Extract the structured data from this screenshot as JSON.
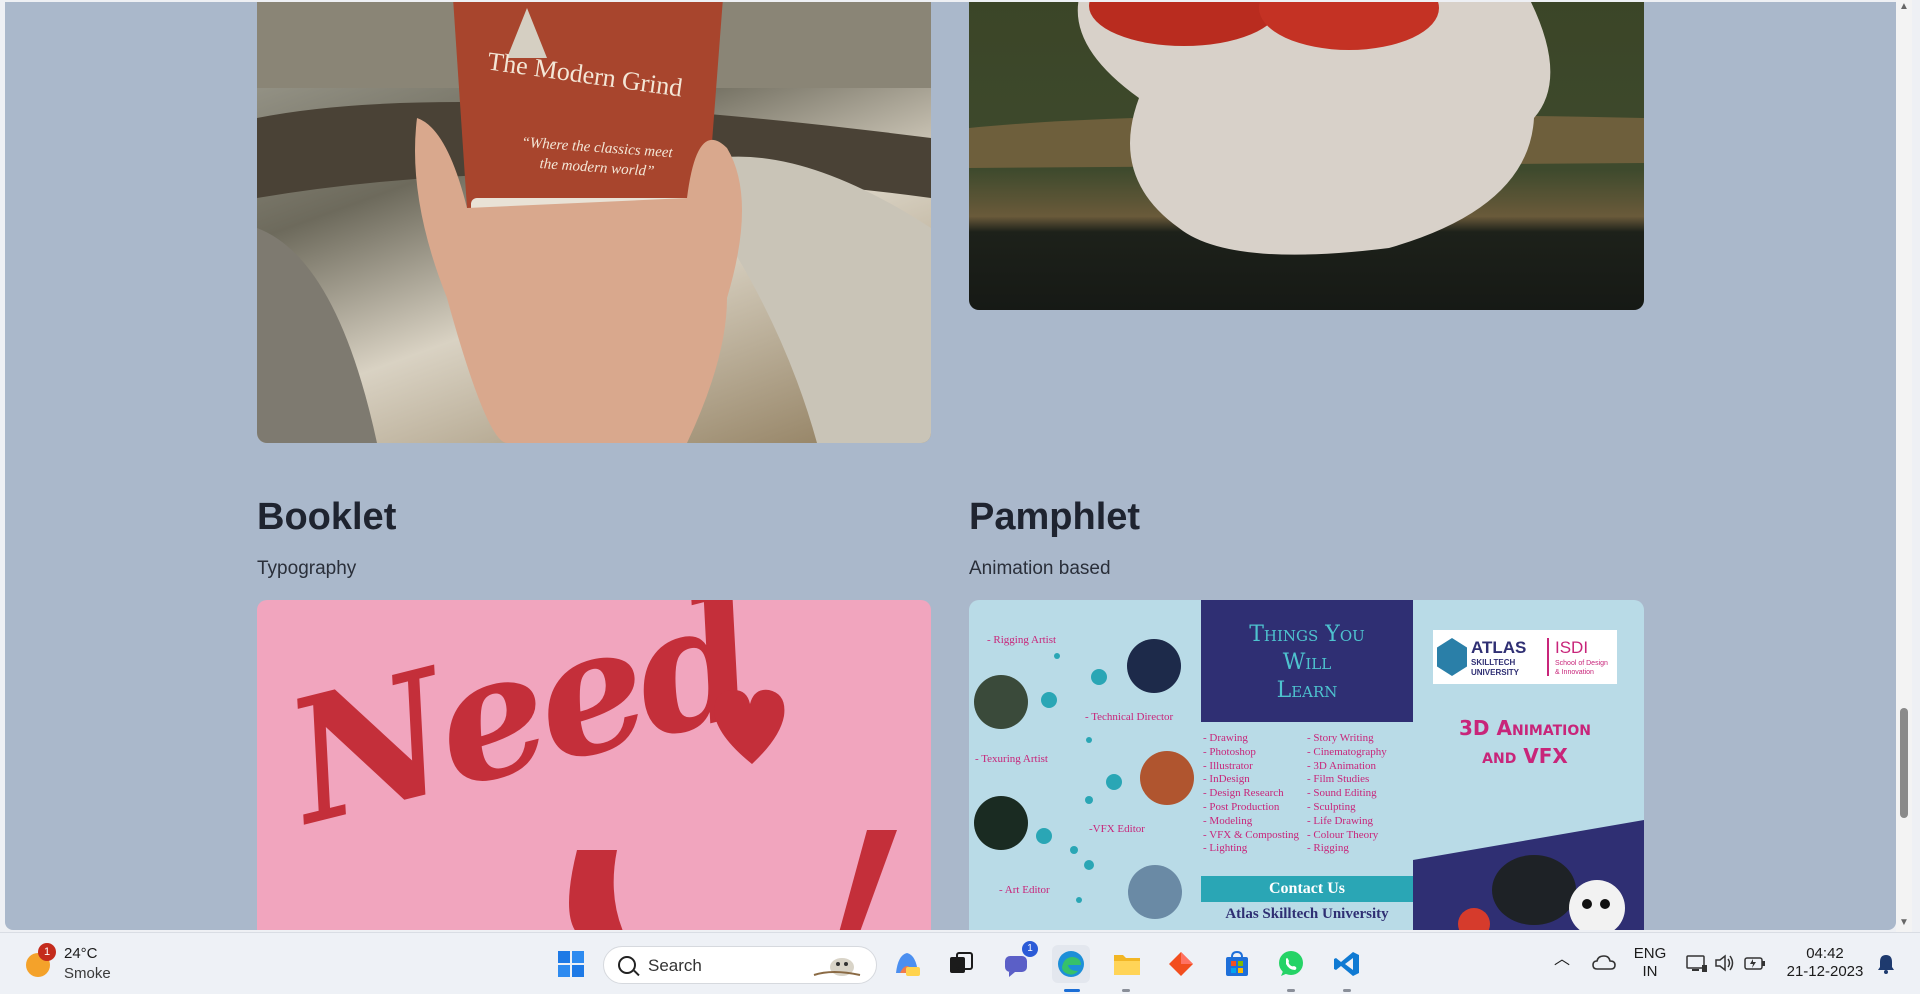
{
  "cards": [
    {
      "title": "Booklet",
      "subtitle": "Typography"
    },
    {
      "title": "Pamphlet",
      "subtitle": "Animation based"
    }
  ],
  "coffee_image": {
    "brand": "The Modern Grind",
    "tagline_1": "“Where the classics meet",
    "tagline_2": "the modern world”"
  },
  "booklet_image": {
    "text": "Need"
  },
  "pamphlet_image": {
    "roles": [
      "- Rigging Artist",
      "- Technical Director",
      "- Texuring Artist",
      "-VFX Editor",
      "- Art Editor"
    ],
    "heading_1": "Things You",
    "heading_2": "Will",
    "heading_3": "Learn",
    "skills_left": [
      "- Drawing",
      "- Photoshop",
      "- Illustrator",
      "- InDesign",
      "- Design Research",
      "- Post Production",
      "- Modeling",
      "- VFX & Composting",
      "- Lighting"
    ],
    "skills_right": [
      "- Story Writing",
      "- Cinematography",
      "- 3D Animation",
      "- Film Studies",
      "- Sound Editing",
      "- Sculpting",
      "- Life Drawing",
      "- Colour Theory",
      "- Rigging"
    ],
    "contact": "Contact Us",
    "university": "Atlas Skilltech University",
    "logo_1": "ATLAS",
    "logo_2": "SKILLTECH",
    "logo_3": "UNIVERSITY",
    "logo_4": "ISDI",
    "logo_5": "School of Design",
    "logo_6": "& Innovation",
    "program_1": "3D Animation",
    "program_2": "and VFX"
  },
  "taskbar": {
    "weather_badge": "1",
    "temperature": "24°C",
    "condition": "Smoke",
    "search_placeholder": "Search",
    "teams_badge": "1",
    "lang_1": "ENG",
    "lang_2": "IN",
    "time": "04:42",
    "date": "21-12-2023"
  },
  "colors": {
    "page_bg": "#aab8cb",
    "booklet_bg": "#f1a5be",
    "pamphlet_bg": "#b9dbe7",
    "pamphlet_heading_bg": "#2f2f73",
    "accent_magenta": "#c8257a"
  }
}
